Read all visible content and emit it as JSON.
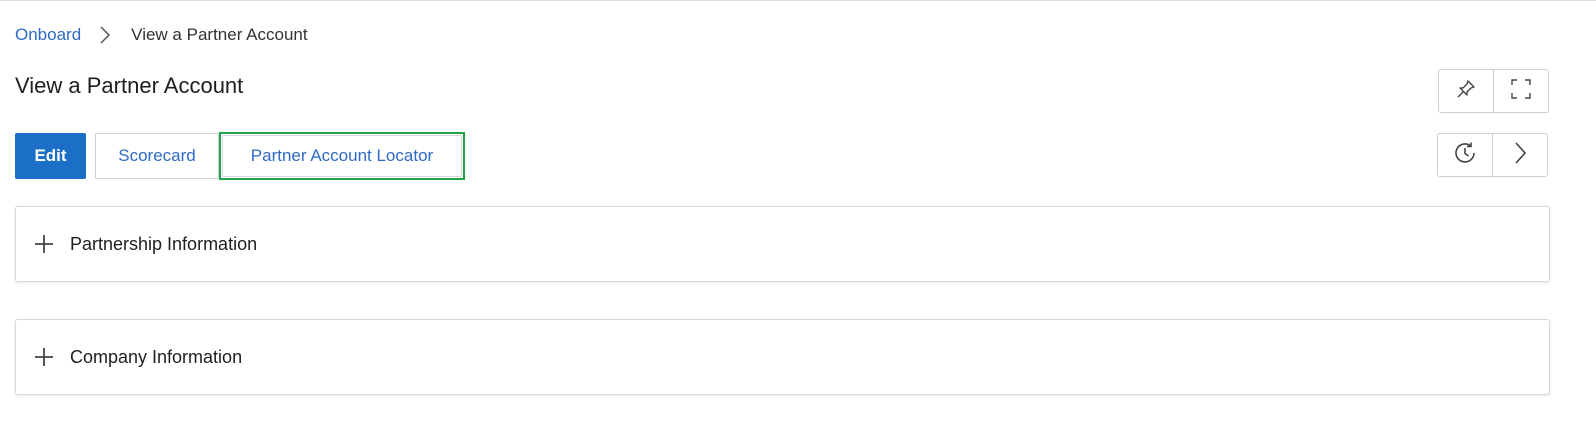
{
  "breadcrumb": {
    "items": [
      {
        "label": "Onboard"
      },
      {
        "label": "View a Partner Account"
      }
    ]
  },
  "page": {
    "title": "View a Partner Account"
  },
  "toolbar": {
    "edit_label": "Edit",
    "scorecard_label": "Scorecard",
    "locator_label": "Partner Account Locator"
  },
  "header_tools": {
    "icons": [
      "pin-icon",
      "expand-icon"
    ]
  },
  "action_tools": {
    "icons": [
      "history-icon",
      "chevron-right-icon"
    ]
  },
  "sections": [
    {
      "title": "Partnership Information",
      "icon": "plus-icon"
    },
    {
      "title": "Company Information",
      "icon": "plus-icon"
    }
  ],
  "colors": {
    "primary": "#1b6fc6",
    "link": "#2f6ac4",
    "highlight_outline": "#1ea24a"
  }
}
